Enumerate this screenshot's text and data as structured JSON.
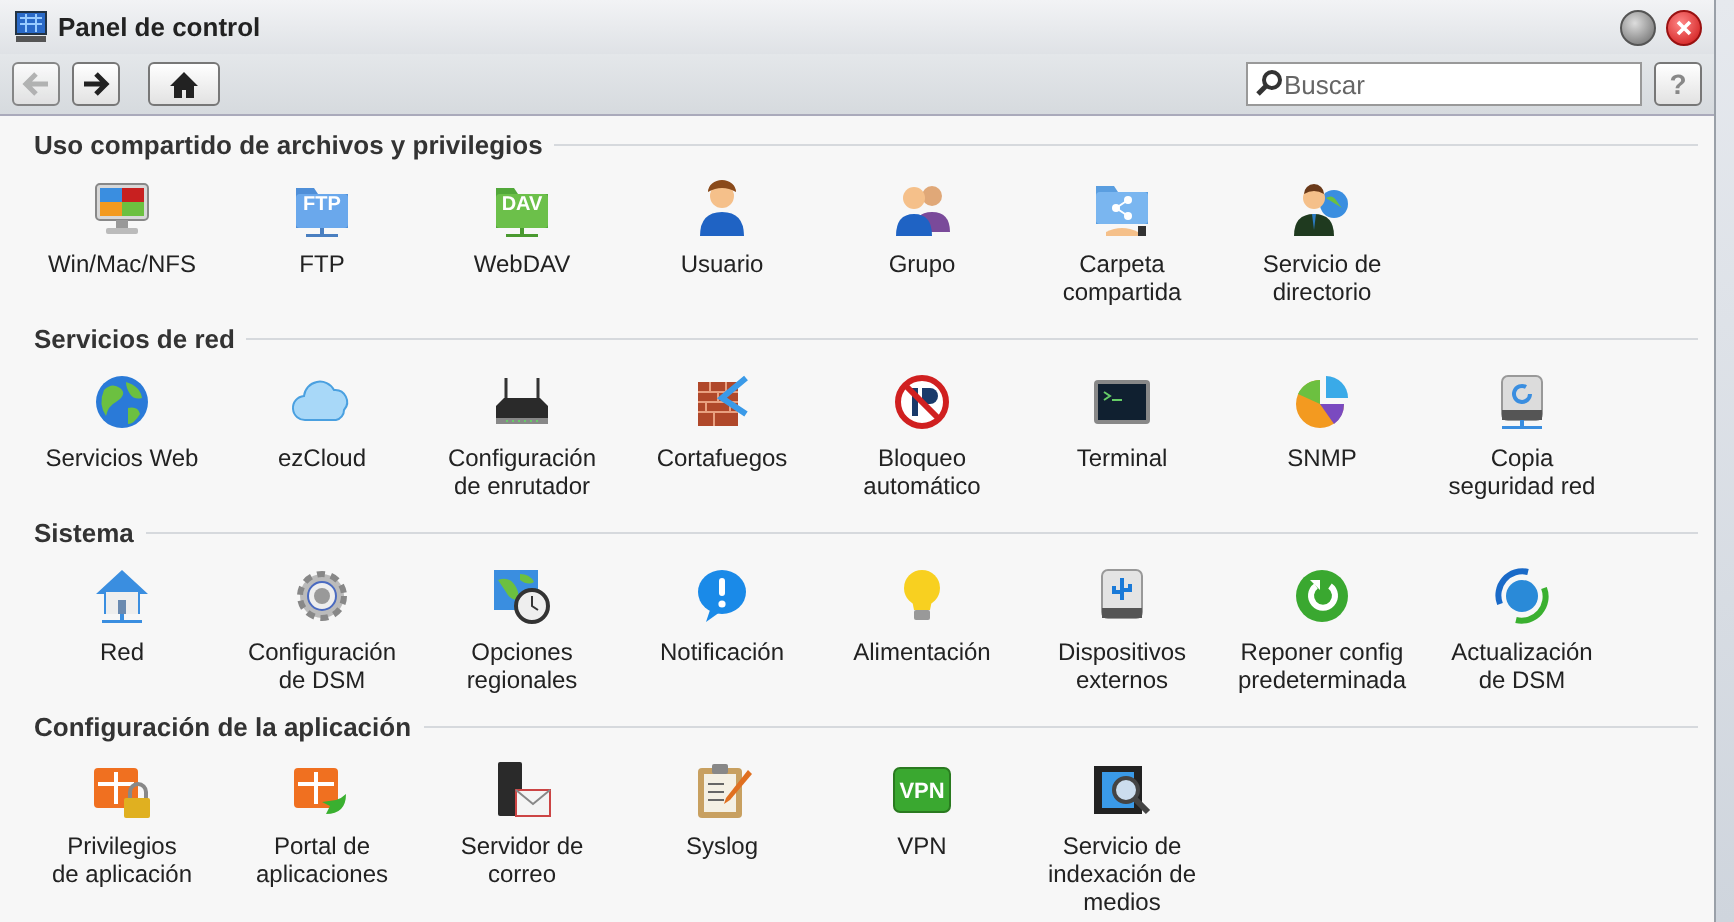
{
  "window": {
    "title": "Panel de control"
  },
  "toolbar": {
    "back": {
      "disabled": true
    },
    "search": {
      "placeholder": "Buscar"
    },
    "help": "?"
  },
  "sections": [
    {
      "title": "Uso compartido de archivos y privilegios",
      "items": [
        {
          "label": "Win/Mac/NFS"
        },
        {
          "label": "FTP",
          "badge": "FTP"
        },
        {
          "label": "WebDAV",
          "badge": "DAV"
        },
        {
          "label": "Usuario"
        },
        {
          "label": "Grupo"
        },
        {
          "label": "Carpeta\ncompartida"
        },
        {
          "label": "Servicio de\ndirectorio"
        }
      ]
    },
    {
      "title": "Servicios de red",
      "items": [
        {
          "label": "Servicios Web"
        },
        {
          "label": "ezCloud"
        },
        {
          "label": "Configuración\nde enrutador"
        },
        {
          "label": "Cortafuegos"
        },
        {
          "label": "Bloqueo\nautomático"
        },
        {
          "label": "Terminal"
        },
        {
          "label": "SNMP"
        },
        {
          "label": "Copia\nseguridad red"
        }
      ]
    },
    {
      "title": "Sistema",
      "items": [
        {
          "label": "Red"
        },
        {
          "label": "Configuración\nde DSM"
        },
        {
          "label": "Opciones\nregionales"
        },
        {
          "label": "Notificación"
        },
        {
          "label": "Alimentación"
        },
        {
          "label": "Dispositivos\nexternos"
        },
        {
          "label": "Reponer config\npredeterminada"
        },
        {
          "label": "Actualización\nde DSM"
        }
      ]
    },
    {
      "title": "Configuración de la aplicación",
      "items": [
        {
          "label": "Privilegios\nde aplicación"
        },
        {
          "label": "Portal de\naplicaciones"
        },
        {
          "label": "Servidor de\ncorreo"
        },
        {
          "label": "Syslog"
        },
        {
          "label": "VPN",
          "badge": "VPN"
        },
        {
          "label": "Servicio de\nindexación de\nmedios"
        }
      ]
    }
  ]
}
